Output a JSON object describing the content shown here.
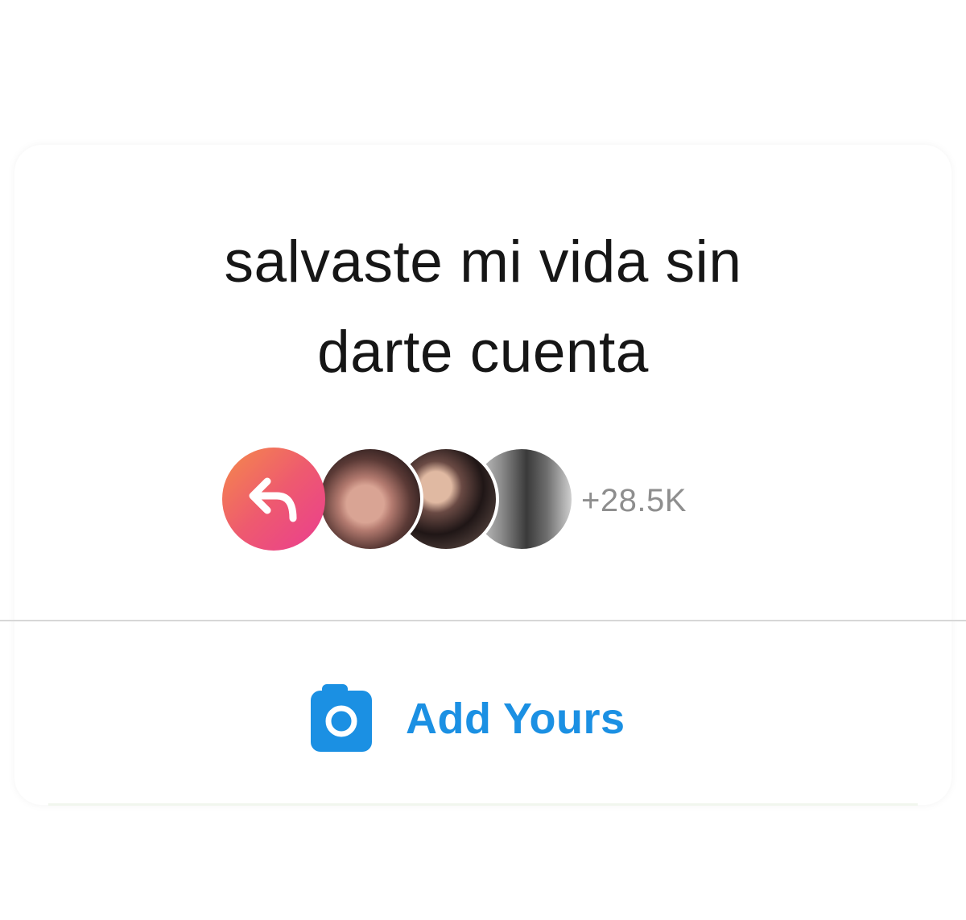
{
  "prompt": {
    "line1": "salvaste mi vida sin",
    "line2": "darte cuenta"
  },
  "participants": {
    "count_label": "+28.5K",
    "share_icon": "reply-arrow-icon",
    "share_gradient": [
      "#f58a4a",
      "#ea3d90"
    ]
  },
  "action": {
    "label": "Add Yours",
    "icon": "camera-icon",
    "color": "#1b90e3"
  }
}
